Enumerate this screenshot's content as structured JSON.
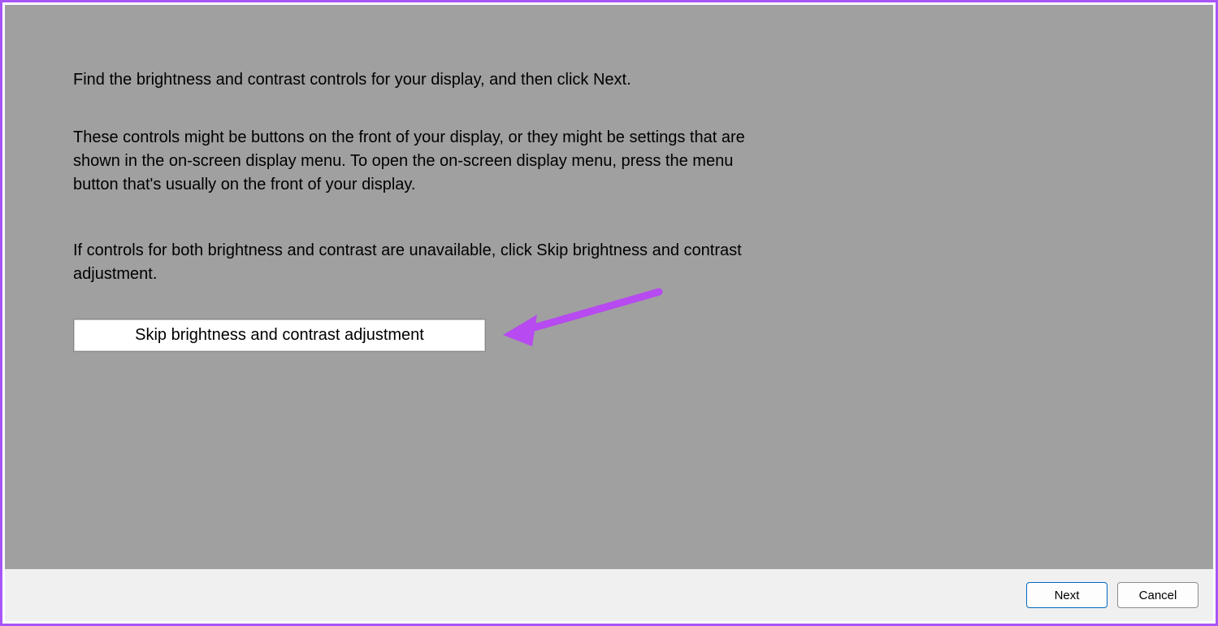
{
  "content": {
    "line1": "Find the brightness and contrast controls for your display, and then click Next.",
    "line2": "These controls might be buttons on the front of your display, or they might be settings that are shown in the on-screen display menu. To open the on-screen display menu, press the menu button that's usually on the front of your display.",
    "line3": "If controls for both brightness and contrast are unavailable, click Skip brightness and contrast adjustment.",
    "skip_label": "Skip brightness and contrast adjustment"
  },
  "footer": {
    "next_label": "Next",
    "cancel_label": "Cancel"
  },
  "colors": {
    "frame_border": "#a855f7",
    "content_bg": "#a0a0a0",
    "footer_bg": "#f0f0f0",
    "primary_border": "#0067c0",
    "annotation": "#b74af0"
  }
}
